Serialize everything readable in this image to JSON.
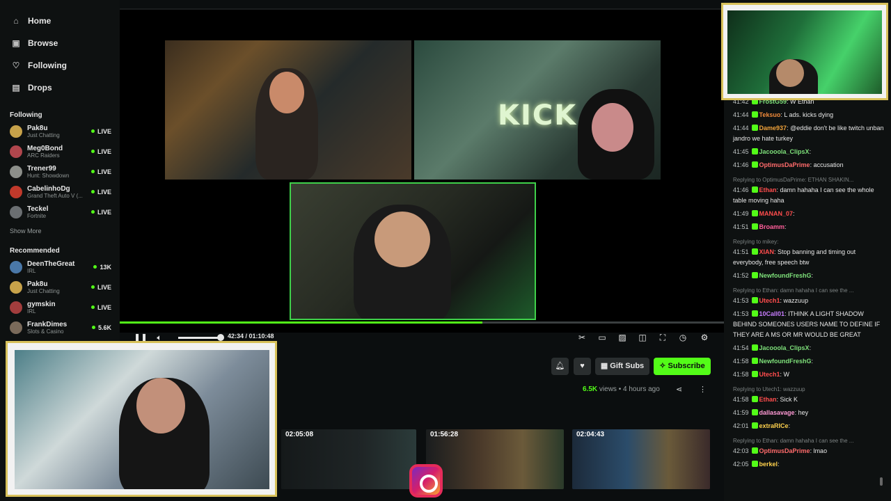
{
  "nav": [
    {
      "label": "Home",
      "icon": "home-icon"
    },
    {
      "label": "Browse",
      "icon": "browse-icon"
    },
    {
      "label": "Following",
      "icon": "heart-icon"
    },
    {
      "label": "Drops",
      "icon": "gift-icon"
    }
  ],
  "following_title": "Following",
  "following": [
    {
      "name": "Pak8u",
      "category": "Just Chatting",
      "status": "LIVE",
      "avatar_color": "#c7a24a"
    },
    {
      "name": "Meg0Bond",
      "category": "ARC Raiders",
      "status": "LIVE",
      "avatar_color": "#b0464d"
    },
    {
      "name": "Trener99",
      "category": "Hunt: Showdown",
      "status": "LIVE",
      "avatar_color": "#8c8f8a"
    },
    {
      "name": "CabelinhoDg",
      "category": "Grand Theft Auto V (...",
      "status": "LIVE",
      "avatar_color": "#c0392b"
    },
    {
      "name": "Teckel",
      "category": "Fortnite",
      "status": "LIVE",
      "avatar_color": "#6b6f72"
    }
  ],
  "show_more": "Show More",
  "recommended_title": "Recommended",
  "recommended": [
    {
      "name": "DeenTheGreat",
      "category": "IRL",
      "status": "13K",
      "avatar_color": "#4a78a8"
    },
    {
      "name": "Pak8u",
      "category": "Just Chatting",
      "status": "LIVE",
      "avatar_color": "#c7a24a"
    },
    {
      "name": "gymskin",
      "category": "IRL",
      "status": "LIVE",
      "avatar_color": "#a23d3d"
    },
    {
      "name": "FrankDimes",
      "category": "Slots & Casino",
      "status": "5.6K",
      "avatar_color": "#7a6a5a"
    }
  ],
  "player": {
    "neon_text": "KICK",
    "time": "42:34 / 01:10:48",
    "progress": 0.6,
    "volume": 1.0
  },
  "actions": {
    "gift_subs": "Gift Subs",
    "subscribe": "Subscribe",
    "views": "6.5K",
    "views_label": "views",
    "ago": "4 hours ago"
  },
  "clips": [
    {
      "duration": "02:05:08"
    },
    {
      "duration": "01:56:28"
    },
    {
      "duration": "02:04:43"
    }
  ],
  "chat": [
    {
      "time": "41:42",
      "user": "FrostG59",
      "color": "#7ee07a",
      "msg": ": W Ethan"
    },
    {
      "time": "41:44",
      "user": "Teksuo",
      "color": "#f08a3a",
      "msg": ": L ads. kicks dying"
    },
    {
      "time": "41:44",
      "user": "Dame937",
      "color": "#f0a23a",
      "msg": ": @eddie don't be like twitch unban jandro we hate turkey"
    },
    {
      "time": "41:45",
      "user": "Jacooola_ClipsX",
      "color": "#7ee07a",
      "msg": ":"
    },
    {
      "time": "41:46",
      "user": "OptimusDaPrime",
      "color": "#ff6b6b",
      "msg": ": accusation"
    },
    {
      "reply": "Replying to OptimusDaPrime: ETHAN SHAKIN..."
    },
    {
      "time": "41:46",
      "user": "Ethan",
      "color": "#ff4d4d",
      "msg": ": damn hahaha I can see the whole table moving haha"
    },
    {
      "time": "41:49",
      "user": "MANAN_07",
      "color": "#ff4d4d",
      "msg": ":"
    },
    {
      "time": "41:51",
      "user": "Broamm",
      "color": "#ff5e9a",
      "msg": ":"
    },
    {
      "reply": "Replying to mikey:"
    },
    {
      "time": "41:51",
      "user": "XIAN",
      "color": "#ff4d4d",
      "msg": ": Stop banning and timing out everybody, free speech btw"
    },
    {
      "time": "41:52",
      "user": "NewfoundFreshG",
      "color": "#7ee07a",
      "msg": ":"
    },
    {
      "reply": "Replying to Ethan: damn hahaha I can see the ..."
    },
    {
      "time": "41:53",
      "user": "Utech1",
      "color": "#ff4d4d",
      "msg": ": wazzuup"
    },
    {
      "time": "41:53",
      "user": "10Call01",
      "color": "#c77dff",
      "msg": ": ITHINK A LIGHT SHADOW BEHIND SOMEONES USERS NAME TO DEFINE IF THEY ARE A MS OR MR WOULD BE GREAT"
    },
    {
      "time": "41:54",
      "user": "Jacooola_ClipsX",
      "color": "#7ee07a",
      "msg": ":"
    },
    {
      "time": "41:58",
      "user": "NewfoundFreshG",
      "color": "#7ee07a",
      "msg": ":"
    },
    {
      "time": "41:58",
      "user": "Utech1",
      "color": "#ff4d4d",
      "msg": ": W"
    },
    {
      "reply": "Replying to Utech1: wazzuup"
    },
    {
      "time": "41:58",
      "user": "Ethan",
      "color": "#ff4d4d",
      "msg": ": Sick K"
    },
    {
      "time": "41:59",
      "user": "dallasavage",
      "color": "#ff9ad5",
      "msg": ": hey"
    },
    {
      "time": "42:01",
      "user": "extraRICe",
      "color": "#ffd24d",
      "msg": ":"
    },
    {
      "reply": "Replying to Ethan: damn hahaha I can see the ..."
    },
    {
      "time": "42:03",
      "user": "OptimusDaPrime",
      "color": "#ff6b6b",
      "msg": ": lmao"
    },
    {
      "time": "42:05",
      "user": "berkel",
      "color": "#ffd24d",
      "msg": ":"
    }
  ]
}
